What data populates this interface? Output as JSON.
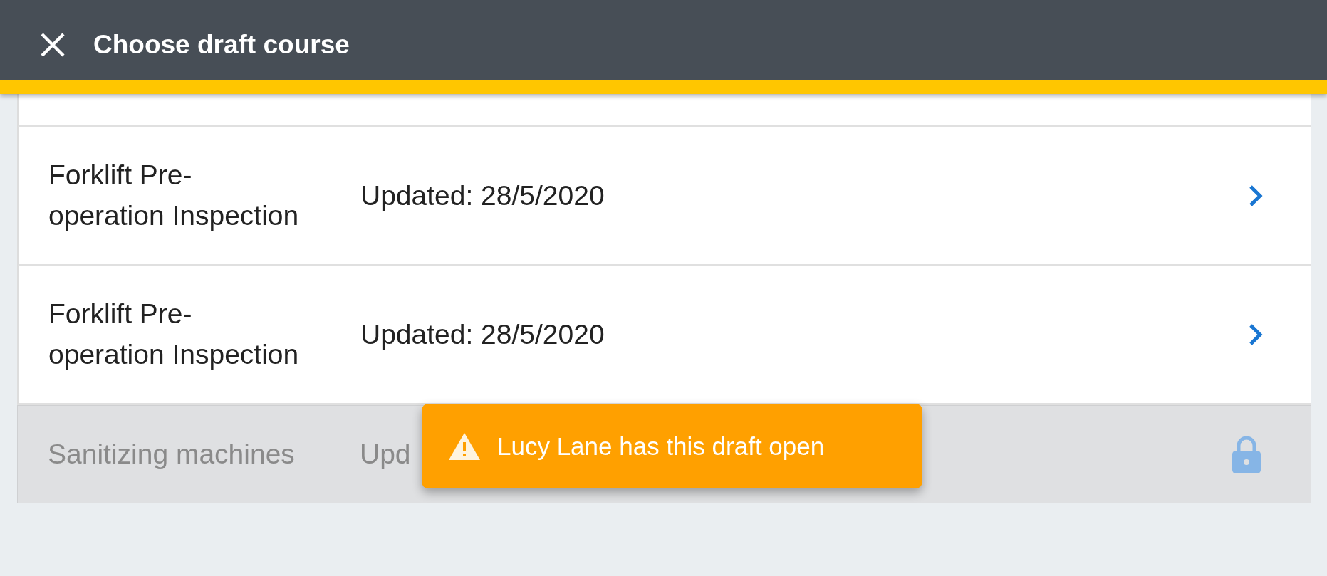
{
  "header": {
    "title": "Choose draft course"
  },
  "rows": [
    {
      "name_lines": [
        "Forklift Pre-",
        "operation Inspection"
      ],
      "updated": "Updated: 28/5/2020",
      "locked": false
    },
    {
      "name_lines": [
        "Forklift Pre-",
        "operation Inspection"
      ],
      "updated": "Updated: 28/5/2020",
      "locked": false
    },
    {
      "name_lines": [
        "Sanitizing machines"
      ],
      "updated": "Upd",
      "locked": true
    }
  ],
  "toast": {
    "message": "Lucy Lane has this draft open"
  }
}
